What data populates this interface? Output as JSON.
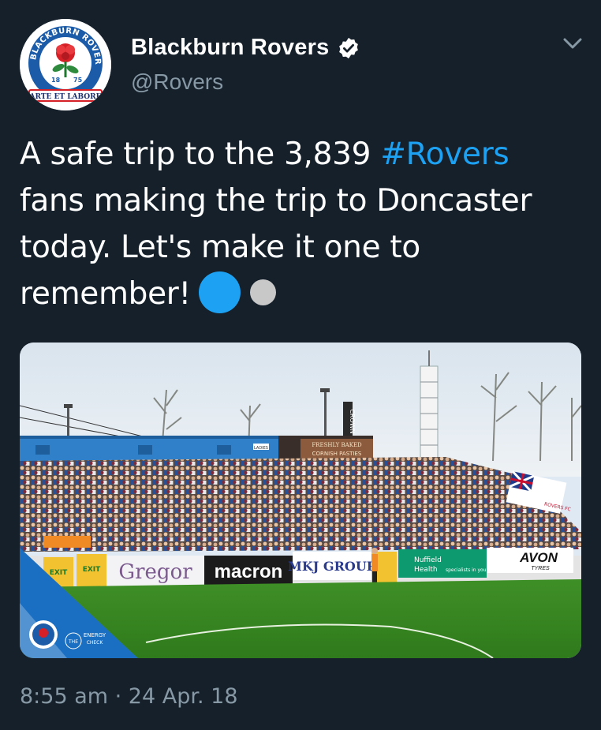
{
  "author": {
    "display_name": "Blackburn Rovers",
    "handle": "@Rovers",
    "avatar": {
      "icon": "club-crest-icon",
      "ring_text": "BLACKBURN ROVERS F.C.",
      "year_left": "18",
      "year_right": "75",
      "motto": "ARTE ET LABORE"
    },
    "verified_icon": "verified-badge-icon"
  },
  "menu_icon": "chevron-down-icon",
  "tweet": {
    "line1_text": "A safe trip to the 3,839 ",
    "line1_hashtag": "#Rovers",
    "line2": "fans making the trip to Doncaster",
    "line3": "today. Let's make it one to",
    "line4": "remember!",
    "emoji": [
      "blue-circle-emoji",
      "white-circle-emoji"
    ]
  },
  "media": {
    "description_icon": "stadium-photo",
    "sign_crown": "CROWN",
    "sign_kiosk_line1": "FRESHLY BAKED",
    "sign_kiosk_line2": "CORNISH PASTIES",
    "sign_ladies": "LADIES",
    "board_gregor": "Gregor",
    "board_macron": "macron",
    "board_mkj": "MKJ GROUP",
    "board_nuffield_1": "Nuffield",
    "board_nuffield_2": "Health",
    "board_nuffield_3": "specialists in you",
    "board_avon": "AVON",
    "board_avon_sub": "TYRES",
    "exit_sign": "EXIT",
    "watermark_sponsor_1": "THE",
    "watermark_sponsor_2": "ENERGY",
    "watermark_sponsor_3": "CHECK",
    "flag_text": "ROVERS FC"
  },
  "timestamp": "8:55 am · 24 Apr. 18",
  "colors": {
    "background": "#15202b",
    "link": "#1da1f2",
    "secondary_text": "#8899a6"
  }
}
